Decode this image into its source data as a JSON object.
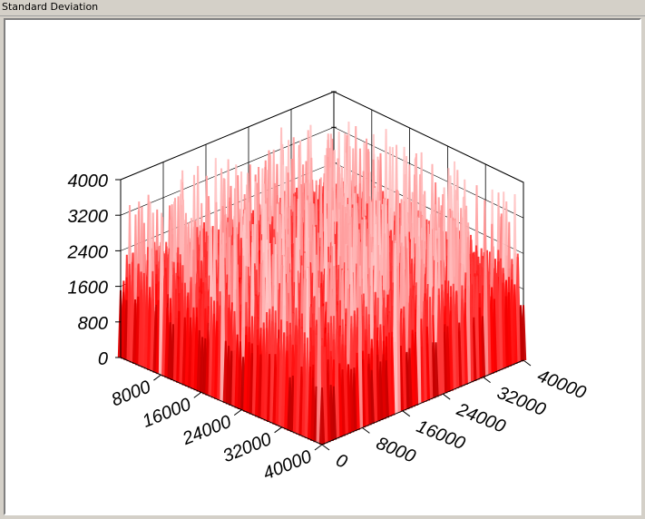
{
  "window": {
    "title": "Standard Deviation"
  },
  "chart_data": {
    "type": "surface",
    "title": "",
    "xlabel": "",
    "ylabel": "",
    "zlabel": "",
    "x_ticks": [
      "0",
      "8000",
      "16000",
      "24000",
      "32000",
      "40000"
    ],
    "y_ticks": [
      "0",
      "8000",
      "16000",
      "24000",
      "32000",
      "40000"
    ],
    "z_ticks": [
      "0",
      "800",
      "1600",
      "2400",
      "3200",
      "4000"
    ],
    "xlim": [
      0,
      40000
    ],
    "ylim": [
      0,
      40000
    ],
    "zlim": [
      0,
      4000
    ],
    "typical_value_range": [
      1200,
      2400
    ],
    "peak_value": 3800,
    "grid": true,
    "colors": {
      "low": "#1a0000",
      "mid": "#ff0000",
      "high": "#ffc8c8",
      "axis": "#000000"
    }
  }
}
